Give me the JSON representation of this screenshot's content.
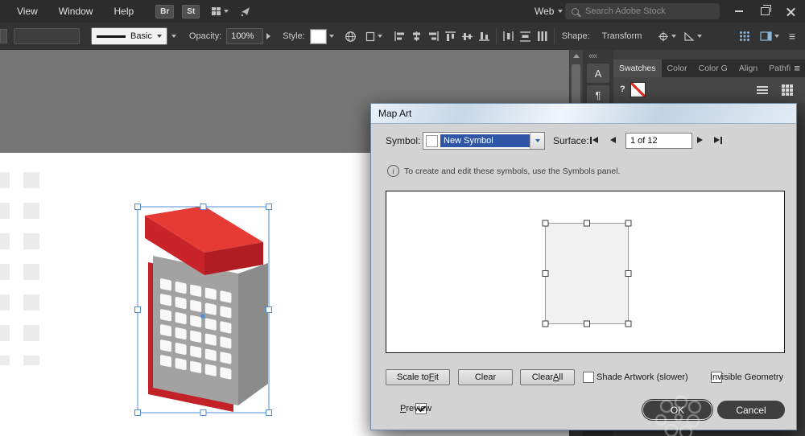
{
  "menubar": {
    "menus": [
      {
        "label": "View"
      },
      {
        "label": "Window"
      },
      {
        "label": "Help"
      }
    ],
    "bridge_label": "Br",
    "stock_label": "St",
    "workspace_label": "Web",
    "search_placeholder": "Search Adobe Stock"
  },
  "toolbar": {
    "stroke_preset": "Basic",
    "opacity_label": "Opacity:",
    "opacity_value": "100%",
    "style_label": "Style:",
    "shape_label": "Shape:",
    "transform_label": "Transform"
  },
  "panels": {
    "tabs": [
      {
        "label": "Swatches",
        "active": true
      },
      {
        "label": "Color",
        "active": false
      },
      {
        "label": "Color G",
        "active": false
      },
      {
        "label": "Align",
        "active": false
      },
      {
        "label": "Pathfi",
        "active": false
      }
    ]
  },
  "dialog": {
    "title": "Map Art",
    "symbol_label": "Symbol:",
    "symbol_value": "New Symbol",
    "surface_label": "Surface:",
    "surface_value": "1 of 12",
    "info_text": "To create and edit these symbols, use the Symbols panel.",
    "buttons": {
      "scale_pre": "Scale to ",
      "scale_mn": "F",
      "scale_post": "it",
      "clear": "Clear",
      "clear_all_pre": "Clear ",
      "clear_all_mn": "A",
      "clear_all_post": "ll",
      "ok": "OK",
      "cancel": "Cancel"
    },
    "checks": {
      "shade_label": "Shade Artwork (slower)",
      "shade_checked": false,
      "invisible_label": "Invisible Geometry",
      "invisible_checked": false,
      "preview_mn": "P",
      "preview_post": "review",
      "preview_checked": true
    }
  },
  "icons": {
    "collapse_glyph": "««",
    "character_glyph": "A",
    "paragraph_glyph": "¶",
    "question_glyph": "?",
    "panel_menu_glyph": "≡",
    "info_glyph": "i"
  },
  "colors": {
    "selection_blue": "#4f8fd9",
    "artwork_red": "#e63b34",
    "dialog_bg": "#d3d3d3",
    "ui_dark": "#2d2d2d"
  }
}
